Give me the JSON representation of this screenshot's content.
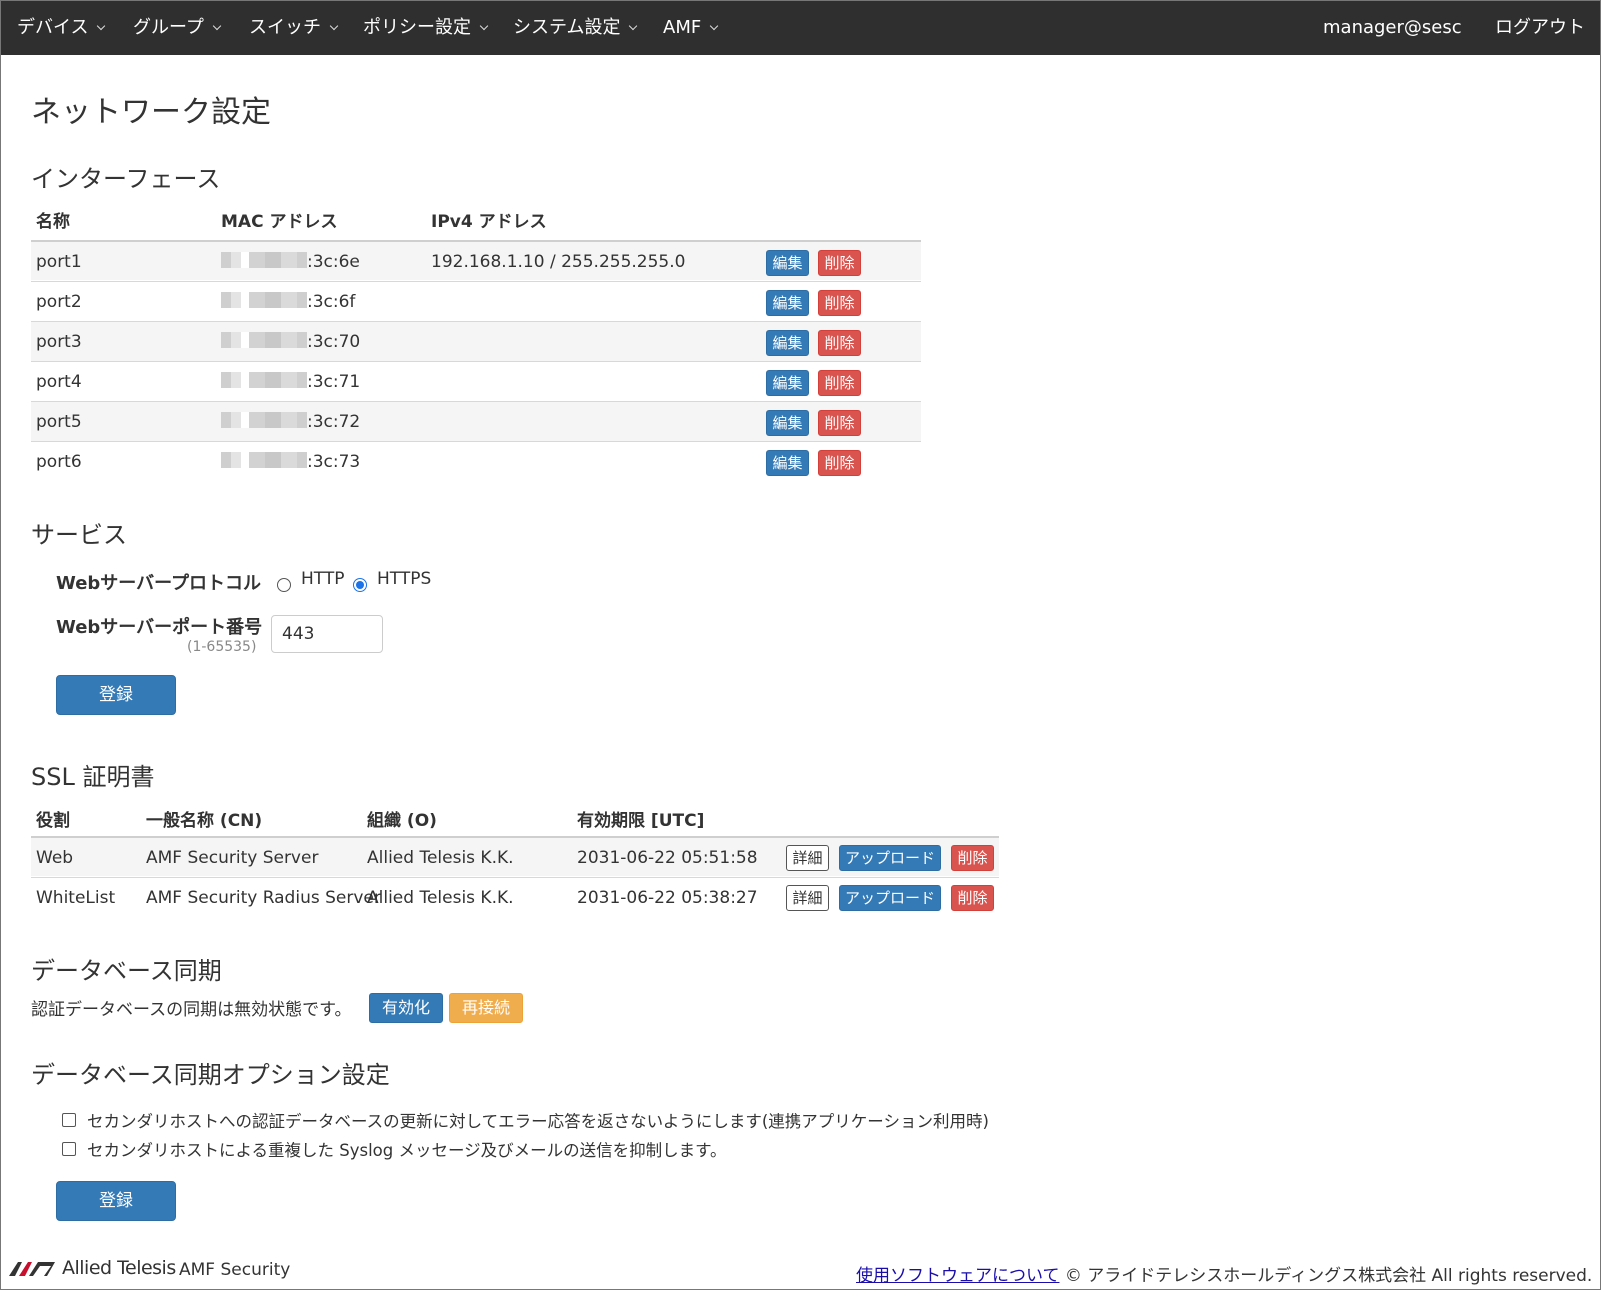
{
  "nav": {
    "items": [
      "デバイス",
      "グループ",
      "スイッチ",
      "ポリシー設定",
      "システム設定",
      "AMF"
    ],
    "user": "manager@sesc",
    "logout": "ログアウト"
  },
  "page": {
    "title": "ネットワーク設定"
  },
  "interfaces": {
    "heading": "インターフェース",
    "columns": [
      "名称",
      "MAC アドレス",
      "IPv4 アドレス"
    ],
    "rows": [
      {
        "name": "port1",
        "mac_suffix": ":3c:6e",
        "ipv4": "192.168.1.10 / 255.255.255.0"
      },
      {
        "name": "port2",
        "mac_suffix": ":3c:6f",
        "ipv4": ""
      },
      {
        "name": "port3",
        "mac_suffix": ":3c:70",
        "ipv4": ""
      },
      {
        "name": "port4",
        "mac_suffix": ":3c:71",
        "ipv4": ""
      },
      {
        "name": "port5",
        "mac_suffix": ":3c:72",
        "ipv4": ""
      },
      {
        "name": "port6",
        "mac_suffix": ":3c:73",
        "ipv4": ""
      }
    ],
    "edit_label": "編集",
    "delete_label": "削除"
  },
  "service": {
    "heading": "サービス",
    "protocol_label": "Webサーバープロトコル",
    "protocol_options": [
      "HTTP",
      "HTTPS"
    ],
    "protocol_selected": "HTTPS",
    "port_label": "Webサーバーポート番号",
    "port_range": "(1-65535)",
    "port_value": "443",
    "submit": "登録"
  },
  "ssl": {
    "heading": "SSL 証明書",
    "columns": [
      "役割",
      "一般名称 (CN)",
      "組織 (O)",
      "有効期限 [UTC]"
    ],
    "rows": [
      {
        "role": "Web",
        "cn": "AMF Security Server",
        "org": "Allied Telesis K.K.",
        "expires": "2031-06-22 05:51:58"
      },
      {
        "role": "WhiteList",
        "cn": "AMF Security Radius Server",
        "org": "Allied Telesis K.K.",
        "expires": "2031-06-22 05:38:27"
      }
    ],
    "detail_label": "詳細",
    "upload_label": "アップロード",
    "delete_label": "削除"
  },
  "dbsync": {
    "heading": "データベース同期",
    "status": "認証データベースの同期は無効状態です。",
    "enable": "有効化",
    "reconnect": "再接続"
  },
  "dbsync_options": {
    "heading": "データベース同期オプション設定",
    "options": [
      {
        "label": "セカンダリホストへの認証データベースの更新に対してエラー応答を返さないようにします(連携アプリケーション利用時)",
        "checked": false
      },
      {
        "label": "セカンダリホストによる重複した Syslog メッセージ及びメールの送信を抑制します。",
        "checked": false
      }
    ],
    "submit": "登録"
  },
  "footer": {
    "brand": "Allied Telesis",
    "product": "AMF Security",
    "software_link": "使用ソフトウェアについて",
    "copyright": "© アライドテレシスホールディングス株式会社 All rights reserved."
  },
  "colors": {
    "navbar": "#2f2f2f",
    "primary": "#337ab7",
    "danger": "#d9534f",
    "warning": "#f0ad4e"
  }
}
